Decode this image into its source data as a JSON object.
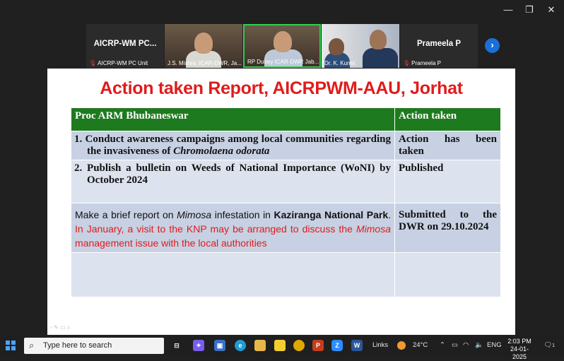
{
  "window": {
    "minimize": "—",
    "maximize": "❐",
    "close": "✕"
  },
  "participants": [
    {
      "label": "AICRP-WM PC...",
      "caption": "AICRP-WM PC Unit",
      "muted": true
    },
    {
      "caption": "J.S. Mishra, ICAR-DWR, Ja...",
      "muted": false
    },
    {
      "caption": "RP Dubey ICAR-DWR Jab...",
      "muted": false
    },
    {
      "caption": "Dr. K. Kurmi",
      "muted": false
    },
    {
      "label": "Prameela P",
      "caption": "Prameela P",
      "muted": true
    }
  ],
  "next_button": "›",
  "slide": {
    "title": "Action taken Report, AICRPWM-AAU, Jorhat",
    "header": {
      "col1": "Proc ARM Bhubaneswar",
      "col2": "Action taken"
    },
    "rows": [
      {
        "num": "1.",
        "text_a": "Conduct awareness campaigns among local communities regarding the invasiveness of ",
        "text_b": "Chromolaena odorata",
        "action": "Action has been taken"
      },
      {
        "num": "2.",
        "text_a": "Publish a bulletin on Weeds of National Importance (WoNI) by October 2024",
        "action": "Published"
      },
      {
        "p1": "Make a brief report on ",
        "p2": "Mimosa",
        "p3": " infestation in ",
        "p4": "Kaziranga National Park",
        "p5": ". ",
        "p6": "In January, a visit to the KNP may be arranged to discuss the ",
        "p7": "Mimosa",
        "p8": " management issue with the local authorities",
        "action": "Submitted to the DWR on 29.10.2024"
      }
    ]
  },
  "taskbar": {
    "search_placeholder": "Type here to search",
    "links": "Links",
    "weather": "24°C",
    "lang": "ENG",
    "time": "2:03 PM",
    "date": "24-01-2025",
    "notif_count": "1",
    "colors": {
      "start": "#4aa3ff",
      "powerpoint": "#c43e1c",
      "word": "#2b579a",
      "zoom": "#2d8cff",
      "chrome": "#e8b700"
    }
  }
}
